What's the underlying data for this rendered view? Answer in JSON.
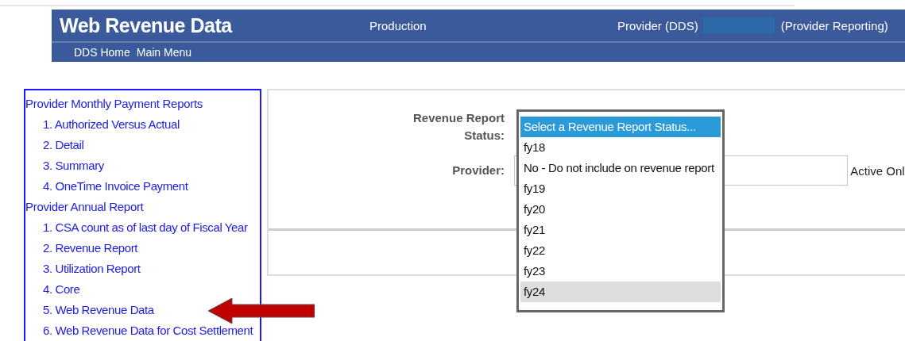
{
  "header": {
    "title": "Web Revenue Data",
    "environment": "Production",
    "provider_label": "Provider (DDS)",
    "role": "(Provider Reporting)",
    "nav": [
      "DDS Home",
      "Main Menu"
    ]
  },
  "sidebar": {
    "sections": [
      {
        "label": "Provider Monthly Payment Reports",
        "children": [
          {
            "label": "1. Authorized Versus Actual"
          },
          {
            "label": "2. Detail"
          },
          {
            "label": "3. Summary"
          },
          {
            "label": "4. OneTime Invoice Payment"
          }
        ]
      },
      {
        "label": "Provider Annual Report",
        "children": [
          {
            "label": "1. CSA count as of last day of Fiscal Year"
          },
          {
            "label": "2. Revenue Report"
          },
          {
            "label": "3. Utilization Report"
          },
          {
            "label": "4. Core"
          },
          {
            "label": "5. Web Revenue Data"
          },
          {
            "label": "6. Web Revenue Data for Cost Settlement"
          }
        ]
      }
    ]
  },
  "form": {
    "status_label": "Revenue Report Status:",
    "provider_label": "Provider:",
    "active_only_label": "Active Onl",
    "status_options": [
      {
        "label": "Select a Revenue Report Status...",
        "selected": true,
        "hovered": false
      },
      {
        "label": "fy18",
        "selected": false,
        "hovered": false
      },
      {
        "label": "No - Do not include on revenue report",
        "selected": false,
        "hovered": false
      },
      {
        "label": "fy19",
        "selected": false,
        "hovered": false
      },
      {
        "label": "fy20",
        "selected": false,
        "hovered": false
      },
      {
        "label": "fy21",
        "selected": false,
        "hovered": false
      },
      {
        "label": "fy22",
        "selected": false,
        "hovered": false
      },
      {
        "label": "fy23",
        "selected": false,
        "hovered": false
      },
      {
        "label": "fy24",
        "selected": false,
        "hovered": true
      }
    ]
  }
}
